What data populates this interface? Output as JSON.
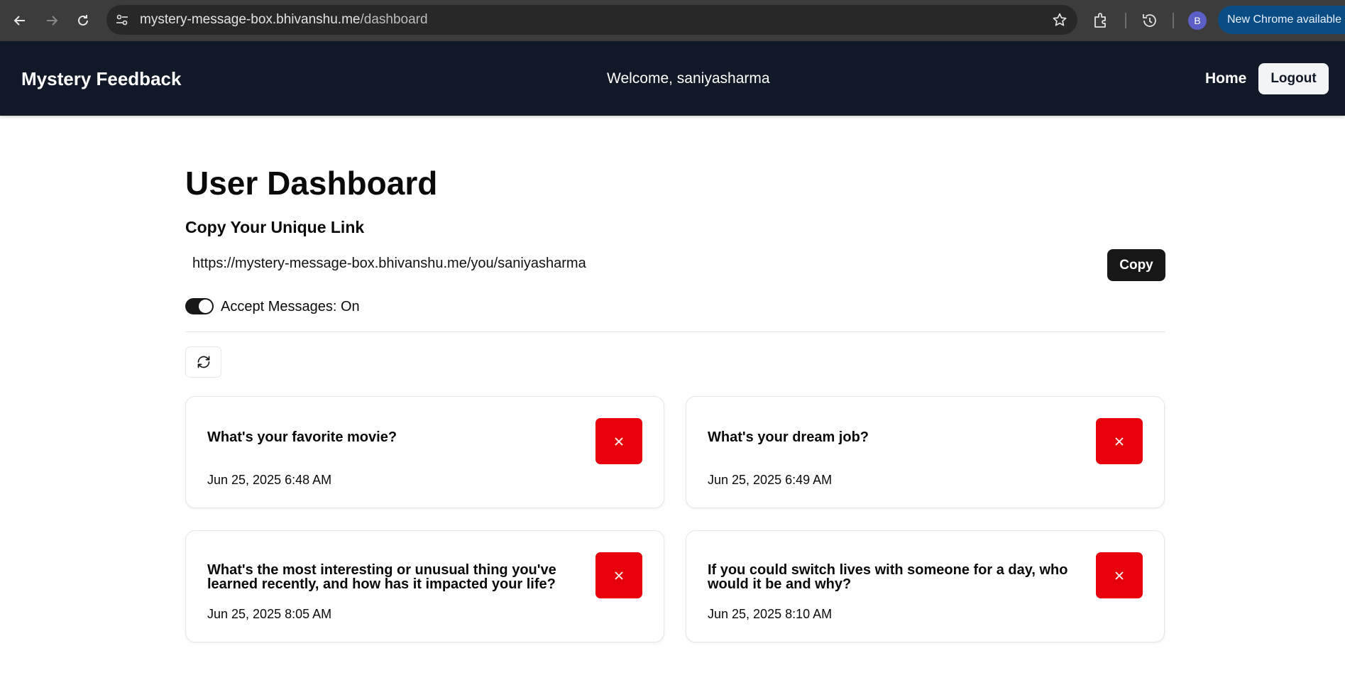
{
  "browser": {
    "url_host": "mystery-message-box.bhivanshu.me",
    "url_path": "/dashboard",
    "profile_initial": "B",
    "update_label": "New Chrome available"
  },
  "nav": {
    "brand": "Mystery Feedback",
    "welcome": "Welcome, saniyasharma",
    "home_label": "Home",
    "logout_label": "Logout"
  },
  "dashboard": {
    "title": "User Dashboard",
    "link_section_title": "Copy Your Unique Link",
    "unique_link": "https://mystery-message-box.bhivanshu.me/you/saniyasharma",
    "copy_label": "Copy",
    "accept_messages_label": "Accept Messages: On",
    "accept_messages": true
  },
  "messages": [
    {
      "text": "What's your favorite movie?",
      "date": "Jun 25, 2025 6:48 AM"
    },
    {
      "text": "What's your dream job?",
      "date": "Jun 25, 2025 6:49 AM"
    },
    {
      "text": "What's the most interesting or unusual thing you've learned recently, and how has it impacted your life?",
      "date": "Jun 25, 2025 8:05 AM"
    },
    {
      "text": "If you could switch lives with someone for a day, who would it be and why?",
      "date": "Jun 25, 2025 8:10 AM"
    }
  ],
  "colors": {
    "nav_bg": "#111827",
    "delete_red": "#e7000b",
    "primary_dark": "#171717"
  }
}
